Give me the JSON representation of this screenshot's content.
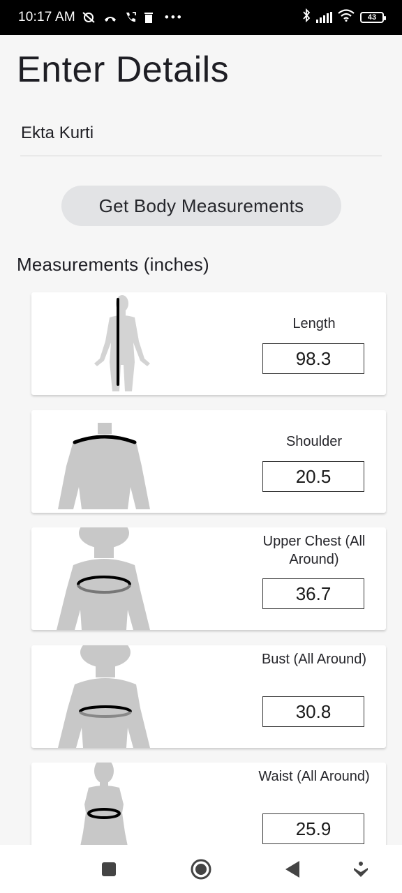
{
  "status_bar": {
    "time": "10:17 AM",
    "battery": "43",
    "icons": [
      "do-not-disturb-icon",
      "missed-call-icon",
      "call-forward-icon",
      "trash-icon",
      "more-icon",
      "bluetooth-icon",
      "signal-icon",
      "wifi-icon",
      "battery-icon"
    ]
  },
  "page": {
    "title": "Enter Details",
    "name_value": "Ekta Kurti",
    "get_measurements_label": "Get Body Measurements",
    "section_title": "Measurements (inches)"
  },
  "measurements": [
    {
      "label": "Length",
      "value": "98.3",
      "figure": "length-figure-icon"
    },
    {
      "label": "Shoulder",
      "value": "20.5",
      "figure": "shoulder-figure-icon"
    },
    {
      "label": "Upper Chest (All Around)",
      "value": "36.7",
      "figure": "upper-chest-figure-icon"
    },
    {
      "label": "Bust (All Around)",
      "value": "30.8",
      "figure": "bust-figure-icon"
    },
    {
      "label": "Waist (All Around)",
      "value": "25.9",
      "figure": "waist-figure-icon"
    }
  ],
  "nav_bar": {
    "icons": [
      "recent-apps-icon",
      "home-icon",
      "back-icon",
      "assistant-icon"
    ]
  },
  "colors": {
    "background": "#f6f6f6",
    "button": "#e2e3e5",
    "silhouette": "#c8c8c8",
    "status_bar": "#000000"
  }
}
